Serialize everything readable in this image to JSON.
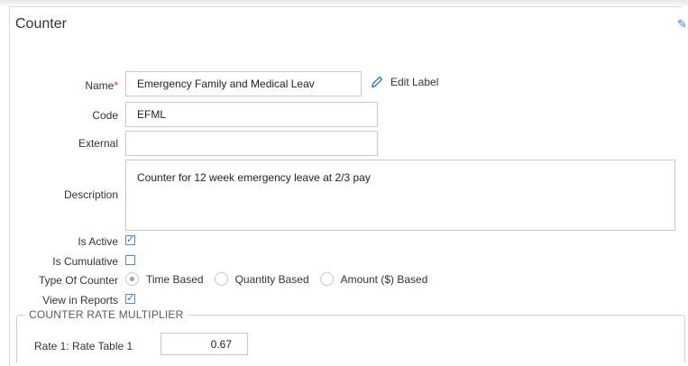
{
  "panel": {
    "title": "Counter"
  },
  "form": {
    "name_label": "Name",
    "required_mark": "*",
    "name_value": "Emergency Family and Medical Leav",
    "edit_label": "Edit Label",
    "code_label": "Code",
    "code_value": "EFML",
    "external_label": "External",
    "external_value": "",
    "description_label": "Description",
    "description_value": "Counter for 12 week emergency leave at 2/3 pay",
    "is_active_label": "Is Active",
    "is_active_checked": true,
    "is_cumulative_label": "Is Cumulative",
    "is_cumulative_checked": false,
    "type_label": "Type Of Counter",
    "type_options": [
      "Time Based",
      "Quantity Based",
      "Amount ($) Based"
    ],
    "type_selected": "Time Based",
    "view_in_reports_label": "View in Reports",
    "view_in_reports_checked": true
  },
  "rate_multiplier": {
    "legend": "COUNTER RATE MULTIPLIER",
    "rate_label": "Rate 1: Rate Table 1",
    "rate_value": "0.67"
  },
  "colors": {
    "accent": "#2b79c7",
    "required": "#d9342b",
    "border": "#c9c9c9"
  }
}
